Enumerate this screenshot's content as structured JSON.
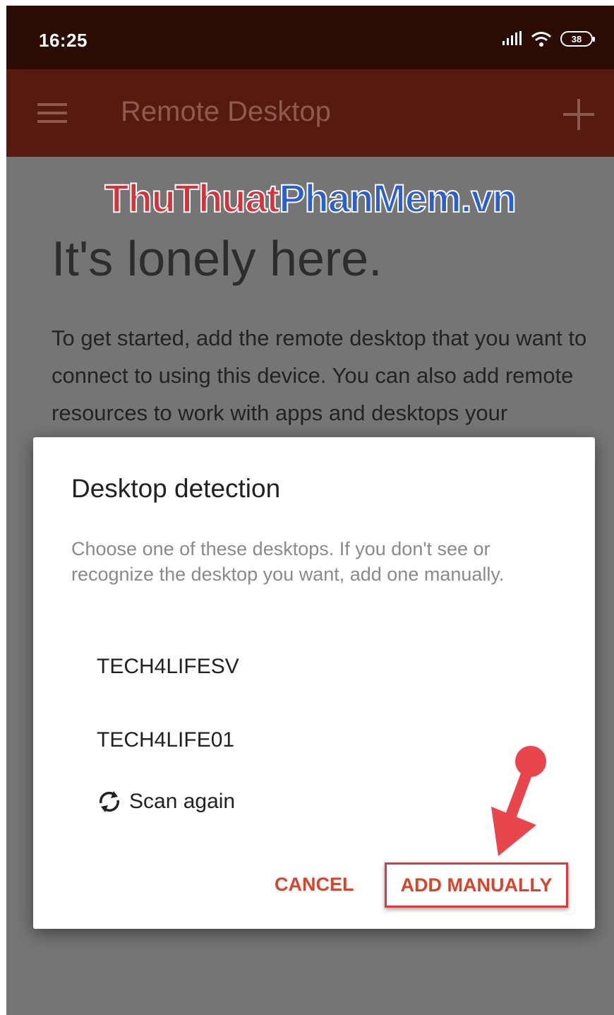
{
  "status_bar": {
    "time": "16:25",
    "battery": "38"
  },
  "app_bar": {
    "title": "Remote Desktop"
  },
  "watermark": {
    "part1": "ThuThuat",
    "part2": "PhanMem",
    "part3": ".vn"
  },
  "empty_state": {
    "title": "It's lonely here.",
    "body": "To get started, add the remote desktop that you want to connect to using this device. You can also add remote resources to work with apps and desktops your administrator has set up for"
  },
  "dialog": {
    "title": "Desktop detection",
    "message": "Choose one of these desktops. If you don't see or recognize the desktop you want, add one manually.",
    "desktops": [
      "TECH4LIFESV",
      "TECH4LIFE01"
    ],
    "scan_label": "Scan again",
    "cancel_label": "CANCEL",
    "add_manually_label": "ADD MANUALLY"
  },
  "colors": {
    "status_bar": "#2b0c04",
    "app_bar": "#561a0f",
    "accent": "#d7442b",
    "highlight": "#e0383f"
  }
}
